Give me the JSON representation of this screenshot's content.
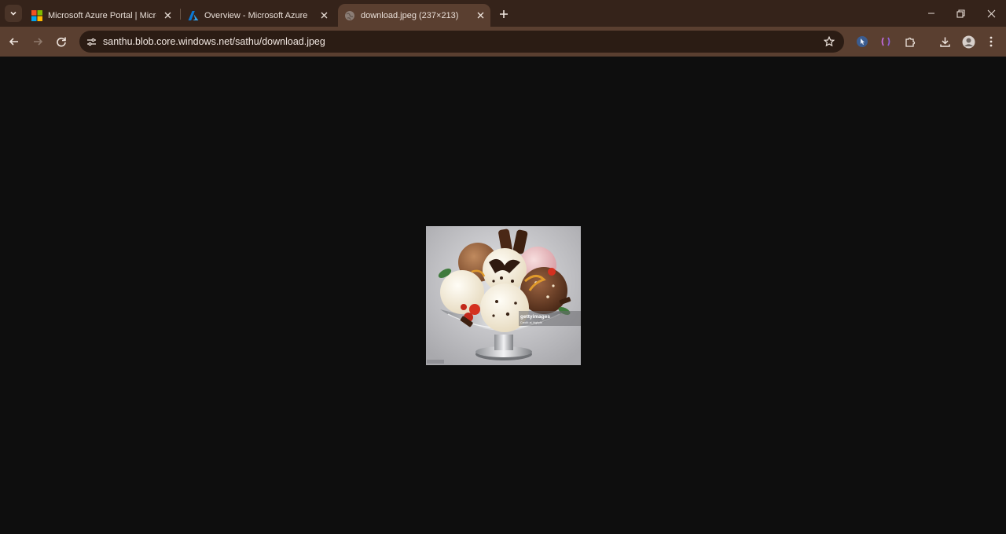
{
  "browser": {
    "tabs": [
      {
        "title": "Microsoft Azure Portal | Microsoft",
        "icon": "microsoft-logo-icon",
        "active": false
      },
      {
        "title": "Overview - Microsoft Azure",
        "icon": "azure-logo-icon",
        "active": false
      },
      {
        "title": "download.jpeg (237×213)",
        "icon": "globe-icon",
        "active": true
      }
    ],
    "url": "santhu.blob.core.windows.net/sathu/download.jpeg"
  },
  "image": {
    "watermark_brand": "gettyimages",
    "watermark_credit": "Credit: ai_bigbyte"
  },
  "colors": {
    "tab_strip": "#35231a",
    "toolbar": "#5a3f30",
    "omnibox": "#2b1c14",
    "page_background": "#0e0e0e"
  }
}
